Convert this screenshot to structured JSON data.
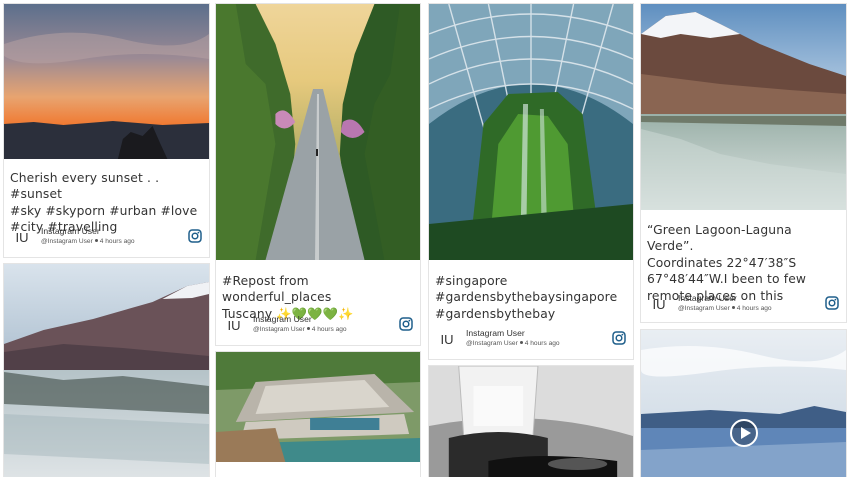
{
  "posts": [
    {
      "caption": "Cherish every sunset . . #sunset\n#sky #skyporn #urban #love\n#city #travelling",
      "user": "Instagram User",
      "handle": "@Instagram User",
      "time": "4 hours ago",
      "avatar": "IU"
    },
    {
      "caption": "#Repost from wonderful_places\nTuscany ✨💚💚💚✨",
      "user": "Instagram User",
      "handle": "@Instagram User",
      "time": "4 hours ago",
      "avatar": "IU"
    },
    {
      "caption": "#singapore\n#gardensbythebaysingapore\n#gardensbythebay",
      "user": "Instagram User",
      "handle": "@Instagram User",
      "time": "4 hours ago",
      "avatar": "IU"
    },
    {
      "caption": "“Green Lagoon-Laguna Verde”.\nCoordinates 22°47′38″S\n67°48′44″W.I been to few\nremote places on this",
      "user": "Instagram User",
      "handle": "@Instagram User",
      "time": "4 hours ago",
      "avatar": "IU"
    }
  ],
  "icons": {
    "instagram": "instagram-icon",
    "play": "play-icon"
  },
  "colors": {
    "accent": "#1f5f8b",
    "border": "#e4e4e4"
  }
}
